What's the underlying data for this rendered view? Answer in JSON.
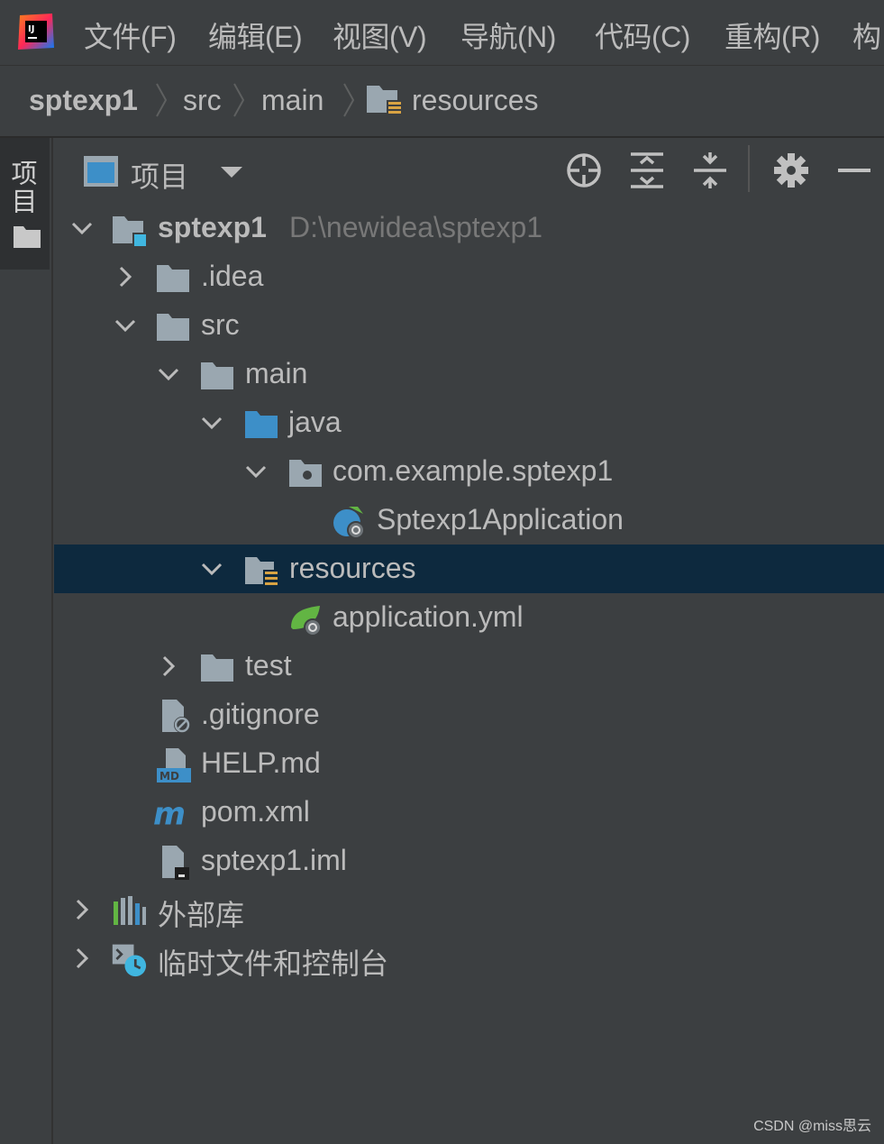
{
  "menu": [
    "文件(F)",
    "编辑(E)",
    "视图(V)",
    "导航(N)",
    "代码(C)",
    "重构(R)",
    "构"
  ],
  "breadcrumb": [
    "sptexp1",
    "src",
    "main",
    "resources"
  ],
  "side_tab": "项目",
  "panel": {
    "title": "项目"
  },
  "tree": [
    {
      "label": "sptexp1",
      "hint": "D:\\newidea\\sptexp1",
      "icon": "module-folder-icon",
      "expanded": true
    },
    {
      "label": ".idea",
      "icon": "folder-icon",
      "expanded": false
    },
    {
      "label": "src",
      "icon": "folder-icon",
      "expanded": true
    },
    {
      "label": "main",
      "icon": "folder-icon",
      "expanded": true
    },
    {
      "label": "java",
      "icon": "source-folder-icon",
      "expanded": true
    },
    {
      "label": "com.example.sptexp1",
      "icon": "package-icon",
      "expanded": true
    },
    {
      "label": "Sptexp1Application",
      "icon": "spring-boot-class-icon"
    },
    {
      "label": "resources",
      "icon": "resources-folder-icon",
      "expanded": true,
      "selected": true
    },
    {
      "label": "application.yml",
      "icon": "spring-config-icon"
    },
    {
      "label": "test",
      "icon": "folder-icon",
      "expanded": false
    },
    {
      "label": ".gitignore",
      "icon": "ignored-file-icon"
    },
    {
      "label": "HELP.md",
      "icon": "markdown-file-icon"
    },
    {
      "label": "pom.xml",
      "icon": "maven-icon"
    },
    {
      "label": "sptexp1.iml",
      "icon": "iml-file-icon"
    },
    {
      "label": "外部库",
      "icon": "library-icon",
      "expanded": false
    },
    {
      "label": "临时文件和控制台",
      "icon": "scratches-icon",
      "expanded": false
    }
  ],
  "watermark": "CSDN @miss思云",
  "colors": {
    "background": "#3c3f41",
    "selection": "#0d293e",
    "folder": "#9aa7b0",
    "source": "#3d8fc8"
  }
}
